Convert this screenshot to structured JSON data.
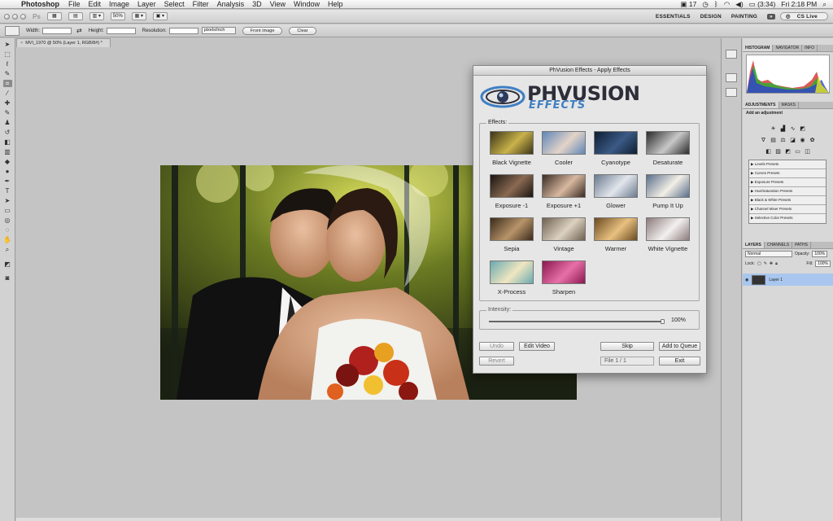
{
  "menubar": {
    "app": "Photoshop",
    "items": [
      "File",
      "Edit",
      "Image",
      "Layer",
      "Select",
      "Filter",
      "Analysis",
      "3D",
      "View",
      "Window",
      "Help"
    ],
    "status": {
      "adobe_count": "17",
      "battery": "(3:34)",
      "clock": "Fri 2:18 PM"
    }
  },
  "appbar": {
    "ps_label": "Ps",
    "zoom": "50%",
    "workspaces": [
      "ESSENTIALS",
      "DESIGN",
      "PAINTING"
    ],
    "more": "»",
    "cs_live": "CS Live"
  },
  "options": {
    "width_label": "Width:",
    "height_label": "Height:",
    "resolution_label": "Resolution:",
    "resolution_unit": "pixels/inch",
    "front_image": "Front Image",
    "clear": "Clear"
  },
  "document": {
    "tab_title": "MVI_1970 @ 50% (Layer 1, RGB/8#) *",
    "close": "×"
  },
  "panels": {
    "top_tabs": [
      "HISTOGRAM",
      "NAVIGATOR",
      "INFO"
    ],
    "adj_tabs": [
      "ADJUSTMENTS",
      "MASKS"
    ],
    "add_adjustment": "Add an adjustment",
    "presets": [
      "Levels Presets",
      "Curves Presets",
      "Exposure Presets",
      "Hue/Saturation Presets",
      "Black & White Presets",
      "Channel Mixer Presets",
      "Selective Color Presets"
    ],
    "layer_tabs": [
      "LAYERS",
      "CHANNELS",
      "PATHS"
    ],
    "blend_mode": "Normal",
    "opacity_label": "Opacity:",
    "opacity_value": "100%",
    "lock_label": "Lock:",
    "fill_label": "Fill:",
    "fill_value": "100%",
    "layer_name": "Layer 1"
  },
  "dialog": {
    "title": "PhVusion Effects - Apply Effects",
    "logo_line1": "PHVUSION",
    "logo_line2": "EFFECTS",
    "effects_legend": "Effects:",
    "effects": [
      {
        "label": "Black Vignette",
        "colors": [
          "#3b3418",
          "#c9b24a"
        ]
      },
      {
        "label": "Cooler",
        "colors": [
          "#5f86b8",
          "#e3d4c8"
        ]
      },
      {
        "label": "Cyanotype",
        "colors": [
          "#0e1e30",
          "#3b5a86"
        ]
      },
      {
        "label": "Desaturate",
        "colors": [
          "#2a2a2a",
          "#c8c8c8"
        ]
      },
      {
        "label": "Exposure -1",
        "colors": [
          "#1a1410",
          "#8a6a52"
        ]
      },
      {
        "label": "Exposure +1",
        "colors": [
          "#3a2a22",
          "#d8b8a0"
        ]
      },
      {
        "label": "Glower",
        "colors": [
          "#6a7a8e",
          "#e2e6ec"
        ]
      },
      {
        "label": "Pump It Up",
        "colors": [
          "#5a6e8a",
          "#f2efe6"
        ]
      },
      {
        "label": "Sepia",
        "colors": [
          "#3a2a1a",
          "#b8946a"
        ]
      },
      {
        "label": "Vintage",
        "colors": [
          "#6e6050",
          "#dcd2c0"
        ]
      },
      {
        "label": "Warmer",
        "colors": [
          "#6a4a20",
          "#e8c080"
        ]
      },
      {
        "label": "White Vignette",
        "colors": [
          "#8a7a7a",
          "#f4f0f0"
        ]
      },
      {
        "label": "X-Process",
        "colors": [
          "#6aaab0",
          "#f0e6c0"
        ]
      },
      {
        "label": "Sharpen",
        "colors": [
          "#8a1850",
          "#e870a8"
        ]
      }
    ],
    "intensity_legend": "Intensity:",
    "intensity_value": "100%",
    "intensity_fraction": 1.0,
    "buttons": {
      "undo": "Undo",
      "edit_video": "Edit Video",
      "skip": "Skip",
      "add_to_queue": "Add to Queue",
      "revert": "Revert",
      "exit": "Exit"
    },
    "file_indicator": "File 1 / 1"
  },
  "colors": {
    "accent_blue": "#3f7fc4",
    "layer_selected": "#a9c7ee"
  }
}
